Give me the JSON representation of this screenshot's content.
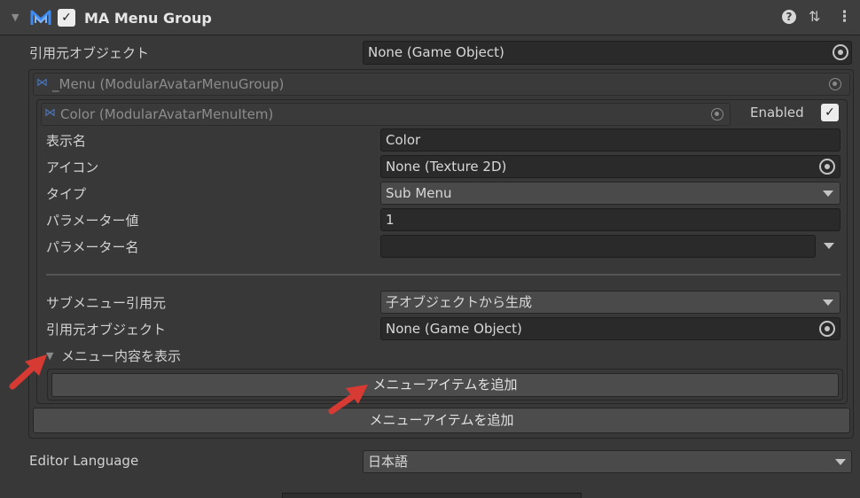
{
  "header": {
    "title": "MA Menu Group",
    "enabled_check": "✓",
    "help_icon": "?",
    "settings_icon": "⇅",
    "more_icon": "⋮",
    "fold_icon": "▼"
  },
  "source_object": {
    "label": "引用元オブジェクト",
    "value": "None (Game Object)"
  },
  "menu_group": {
    "title": "_Menu (ModularAvatarMenuGroup)"
  },
  "menu_item": {
    "title": "Color (ModularAvatarMenuItem)",
    "enabled_label": "Enabled",
    "enabled_check": "✓",
    "fields": {
      "display_name": {
        "label": "表示名",
        "value": "Color"
      },
      "icon": {
        "label": "アイコン",
        "value": "None (Texture 2D)"
      },
      "type": {
        "label": "タイプ",
        "value": "Sub Menu"
      },
      "param_value": {
        "label": "パラメーター値",
        "value": "1"
      },
      "param_name": {
        "label": "パラメーター名",
        "value": ""
      },
      "submenu_source": {
        "label": "サブメニュー引用元",
        "value": "子オブジェクトから生成"
      },
      "source_object": {
        "label": "引用元オブジェクト",
        "value": "None (Game Object)"
      }
    },
    "show_contents": {
      "label": "メニュー内容を表示",
      "fold_icon": "▼"
    },
    "inner_add_button": "メニューアイテムを追加"
  },
  "outer_add_button": "メニューアイテムを追加",
  "editor_language": {
    "label": "Editor Language",
    "value": "日本語"
  },
  "colors": {
    "background": "#383838",
    "field": "#2a2a2a",
    "button": "#4c4c4c",
    "logo": "#3d8bf0",
    "arrow": "#d63a32"
  }
}
